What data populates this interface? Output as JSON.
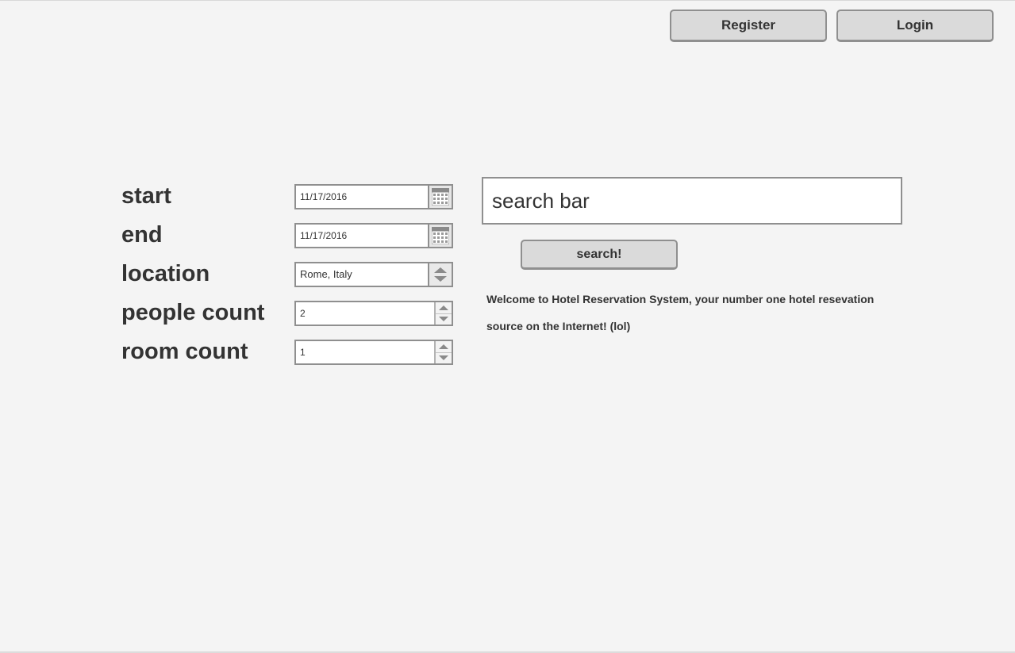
{
  "header": {
    "register_label": "Register",
    "login_label": "Login"
  },
  "form": {
    "start": {
      "label": "start",
      "value": "11/17/2016",
      "icon": "calendar-icon"
    },
    "end": {
      "label": "end",
      "value": "11/17/2016",
      "icon": "calendar-icon"
    },
    "location": {
      "label": "location",
      "value": "Rome, Italy",
      "icon": "up-down-arrows-icon"
    },
    "people_count": {
      "label": "people count",
      "value": "2"
    },
    "room_count": {
      "label": "room count",
      "value": "1"
    }
  },
  "search": {
    "placeholder": "search bar",
    "button_label": "search!"
  },
  "welcome_text": "Welcome to Hotel Reservation System, your number one hotel resevation source on the Internet! (lol)"
}
